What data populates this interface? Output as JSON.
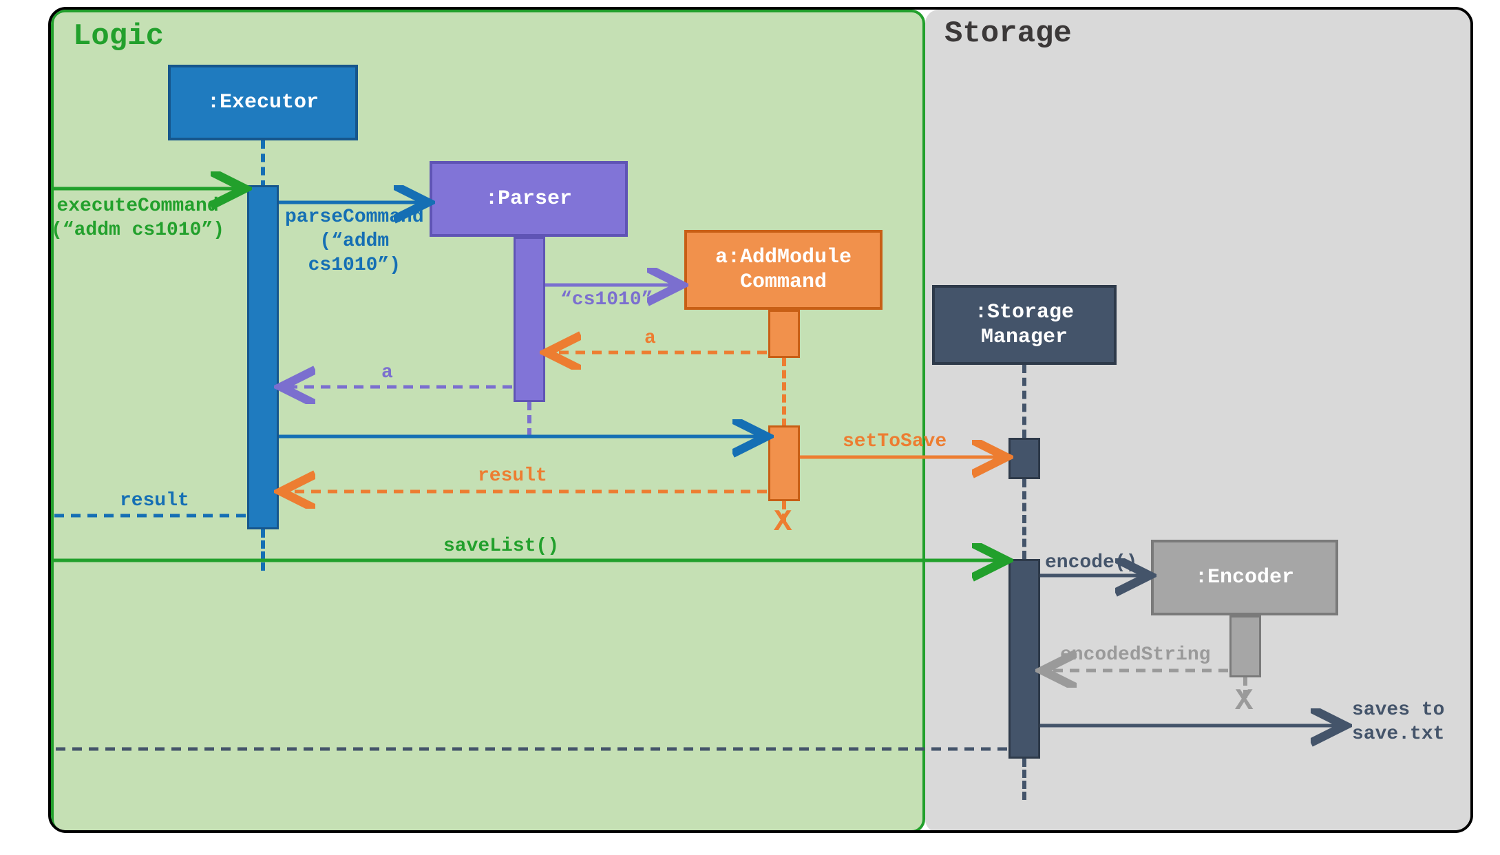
{
  "packages": {
    "logic": "Logic",
    "storage": "Storage"
  },
  "lifelines": {
    "executor": ":Executor",
    "parser": ":Parser",
    "addcmd": "a:AddModule\nCommand",
    "storagemgr": ":Storage\nManager",
    "encoder": ":Encoder"
  },
  "messages": {
    "executeCommand": "executeCommand\n(“addm cs1010”)",
    "parseCommand": "parseCommand\n(“addm\ncs1010”)",
    "cs1010": "“cs1010”",
    "return_a1": "a",
    "return_a2": "a",
    "setToSave": "setToSave",
    "resultBack": "result",
    "resultOut": "result",
    "saveList": "saveList()",
    "encode": "encode()",
    "encodedString": "encodedString",
    "savesTo": "saves to\nsave.txt"
  },
  "colors": {
    "green": "#22a02c",
    "blue": "#156fb4",
    "blueFill": "#1f7bbf",
    "blueBorder": "#16568c",
    "purple": "#7b6fcf",
    "purpleFill": "#8174d7",
    "purpleBorder": "#5f54b5",
    "orange": "#ed7d31",
    "orangeFill": "#f1914c",
    "orangeBorder": "#c85f15",
    "slate": "#44546a",
    "slateBorder": "#2e3a4a",
    "gray": "#9a9a9a",
    "grayFill": "#a6a6a6"
  }
}
